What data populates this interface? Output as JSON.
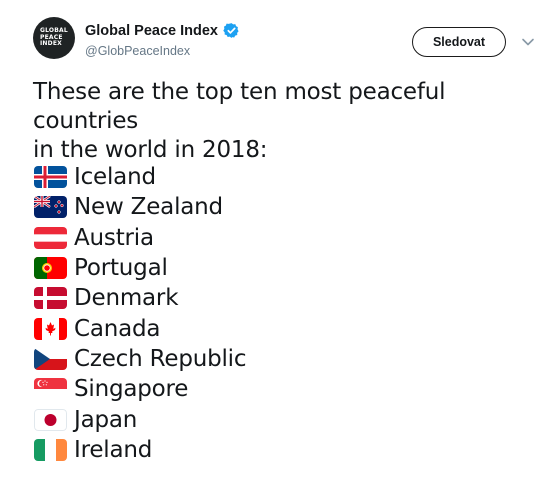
{
  "account": {
    "display_name": "Global Peace Index",
    "handle": "@GlobPeaceIndex",
    "avatar_lines": [
      "GLOBAL",
      "PEACE",
      "INDEX"
    ],
    "verified": true,
    "verified_color": "#1da1f2"
  },
  "actions": {
    "follow_label": "Sledovat",
    "menu_icon": "chevron-down-icon"
  },
  "tweet": {
    "line1": "These are the top ten most peaceful countries",
    "line2": "in the world in 2018:",
    "countries": [
      {
        "name": "Iceland",
        "flag": "iceland-flag-icon"
      },
      {
        "name": "New Zealand",
        "flag": "new-zealand-flag-icon"
      },
      {
        "name": "Austria",
        "flag": "austria-flag-icon"
      },
      {
        "name": "Portugal",
        "flag": "portugal-flag-icon"
      },
      {
        "name": "Denmark",
        "flag": "denmark-flag-icon"
      },
      {
        "name": "Canada",
        "flag": "canada-flag-icon"
      },
      {
        "name": "Czech Republic",
        "flag": "czech-flag-icon"
      },
      {
        "name": "Singapore",
        "flag": "singapore-flag-icon"
      },
      {
        "name": "Japan",
        "flag": "japan-flag-icon"
      },
      {
        "name": "Ireland",
        "flag": "ireland-flag-icon"
      }
    ]
  }
}
